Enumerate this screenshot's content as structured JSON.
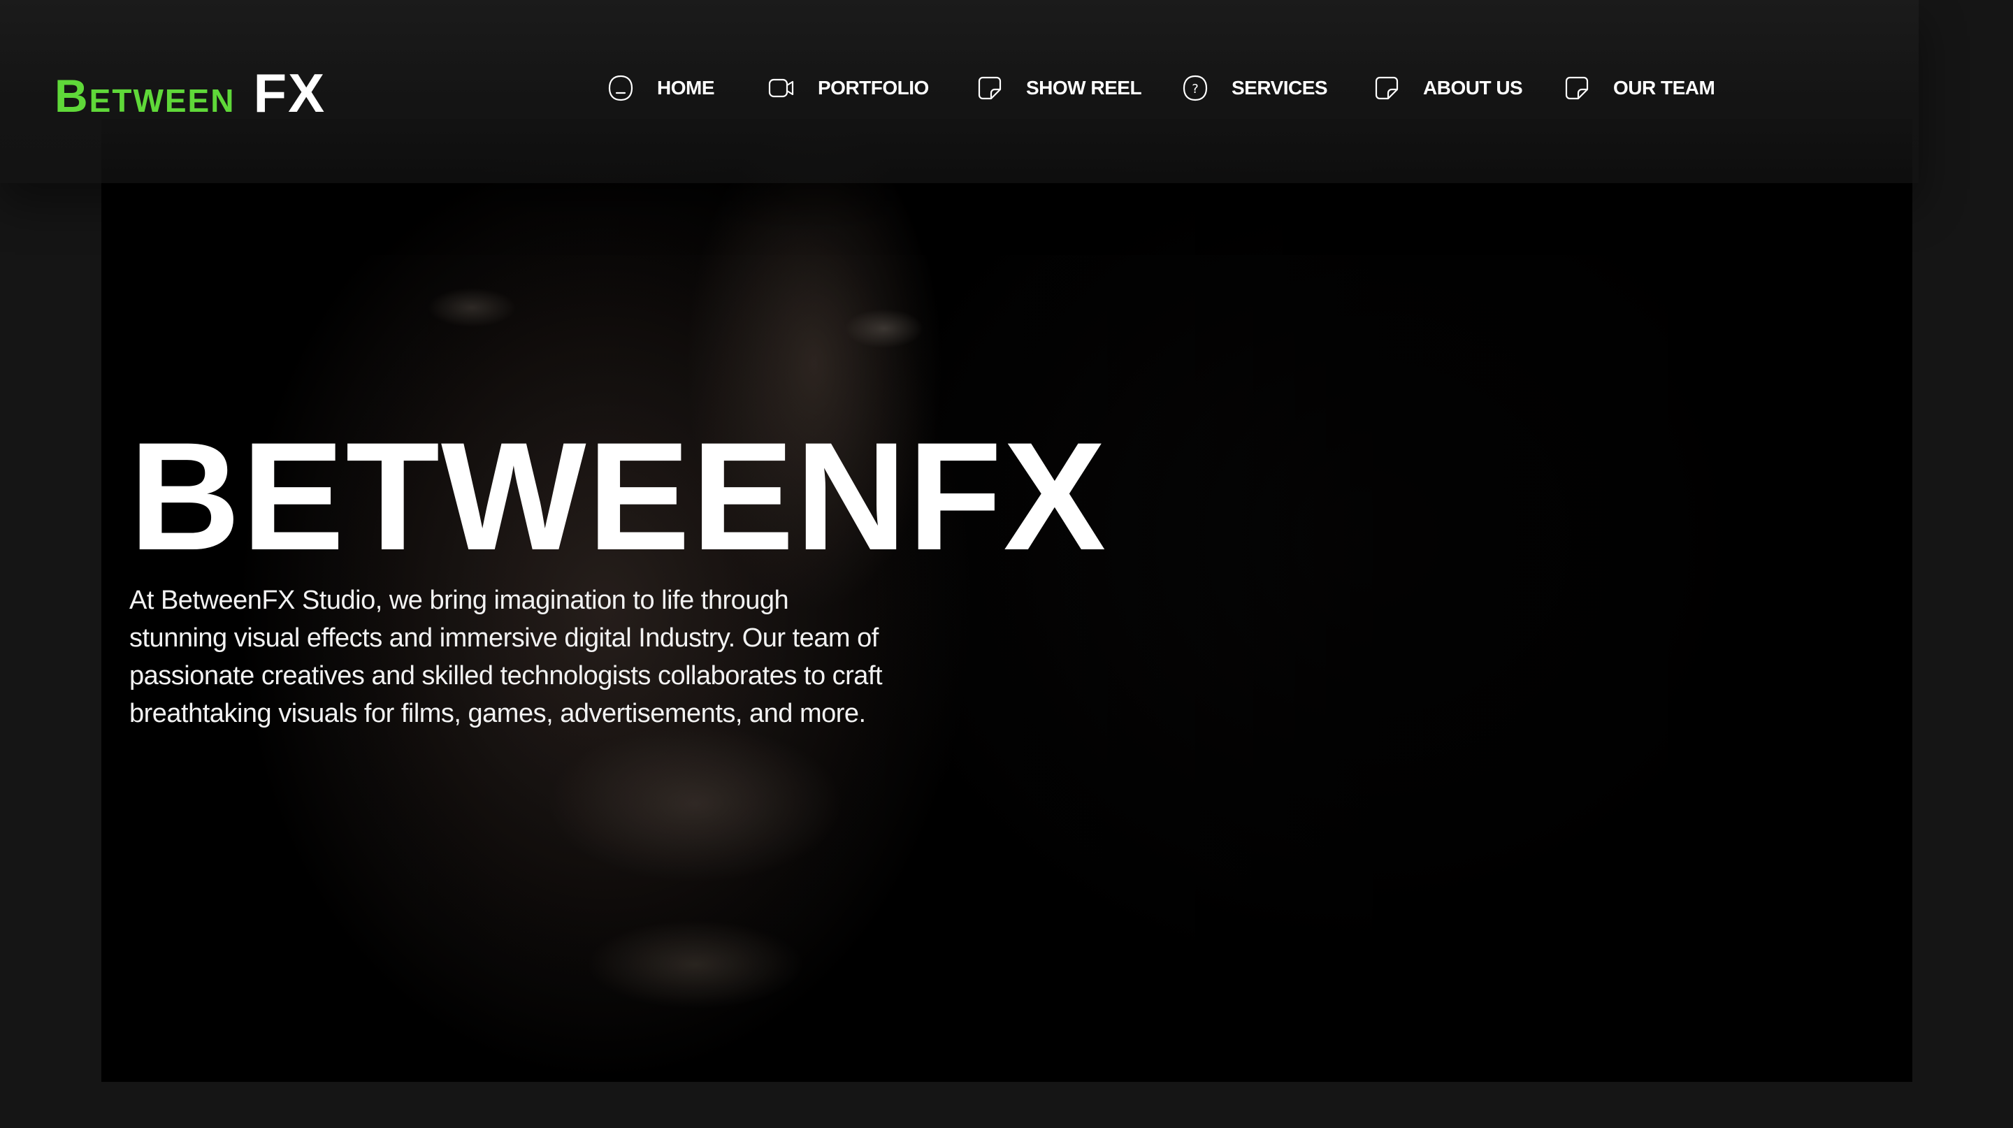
{
  "brand": {
    "logo_part1": "Between",
    "logo_part2": "FX",
    "accent_color": "#5fd839"
  },
  "nav": {
    "items": [
      {
        "label": "HOME",
        "icon": "home-icon"
      },
      {
        "label": "PORTFOLIO",
        "icon": "video-camera-icon"
      },
      {
        "label": "SHOW REEL",
        "icon": "sticky-note-icon"
      },
      {
        "label": "SERVICES",
        "icon": "question-circle-icon"
      },
      {
        "label": "ABOUT US",
        "icon": "sticky-note-icon"
      },
      {
        "label": "OUR TEAM",
        "icon": "sticky-note-icon"
      }
    ]
  },
  "hero": {
    "title": "BETWEENFX",
    "description": "At BetweenFX Studio, we bring imagination to life through stunning visual effects and immersive digital Industry. Our team of passionate creatives and skilled technologists collaborates to craft breathtaking visuals for films, games, advertisements, and more."
  }
}
